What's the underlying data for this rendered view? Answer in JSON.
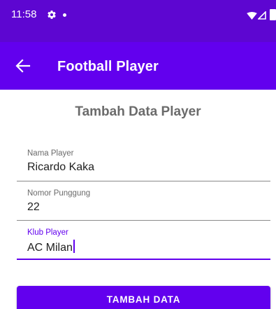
{
  "status_bar": {
    "time": "11:58",
    "icons": [
      "gear-icon",
      "notification-dot",
      "wifi-icon",
      "signal-icon",
      "battery-icon"
    ]
  },
  "app_bar": {
    "title": "Football Player",
    "back_icon": "arrow-back-icon"
  },
  "form": {
    "heading": "Tambah Data Player",
    "fields": [
      {
        "label": "Nama Player",
        "value": "Ricardo Kaka",
        "focused": false
      },
      {
        "label": "Nomor Punggung",
        "value": "22",
        "focused": false
      },
      {
        "label": "Klub Player",
        "value": "AC Milan",
        "focused": true
      }
    ],
    "submit_label": "TAMBAH DATA"
  },
  "colors": {
    "status_bar": "#5d06d1",
    "primary": "#6200ee",
    "heading_text": "#6b6b6b",
    "on_primary": "#ffffff"
  }
}
